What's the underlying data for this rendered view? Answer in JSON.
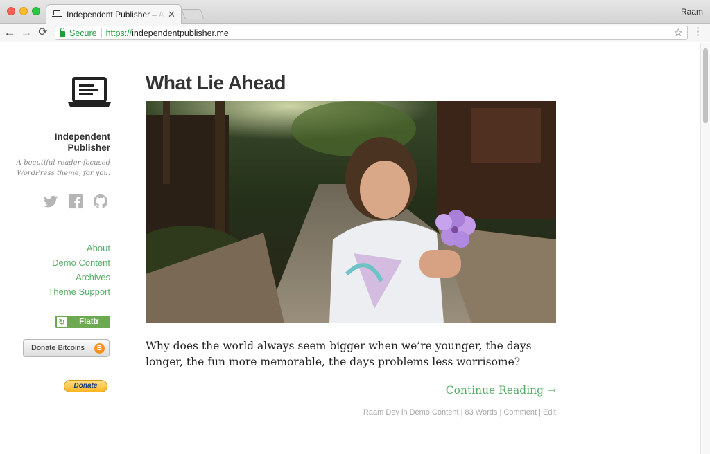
{
  "browser": {
    "tab_title": "Independent Publisher – A beautiful reader-focused WordPress theme, for you.",
    "tab_close": "✕",
    "profile_name": "Raam",
    "secure_label": "Secure",
    "url_scheme": "https://",
    "url_host": "independentpublisher.me",
    "back_icon": "←",
    "forward_icon": "→",
    "reload_icon": "⟳",
    "star_icon": "☆",
    "menu_icon": "⋮"
  },
  "sidebar": {
    "site_title": "Independent Publisher",
    "site_description": "A beautiful reader-focused WordPress theme, for you.",
    "social": [
      "twitter-icon",
      "facebook-icon",
      "github-icon"
    ],
    "nav": [
      {
        "label": "About"
      },
      {
        "label": "Demo Content"
      },
      {
        "label": "Archives"
      },
      {
        "label": "Theme Support"
      }
    ],
    "flattr_label": "Flattr",
    "bitcoin_label": "Donate Bitcoins",
    "bitcoin_symbol": "B",
    "paypal_label": "Donate"
  },
  "post": {
    "title": "What Lie Ahead",
    "excerpt": "Why does the world always seem bigger when we’re younger, the days longer, the fun more memorable, the days problems less worrisome?",
    "continue_label": "Continue Reading →",
    "meta": {
      "author": "Raam Dev",
      "in_word": "in",
      "category": "Demo Content",
      "words": "83 Words",
      "comment": "Comment",
      "edit": "Edit",
      "separator": "|"
    }
  },
  "colors": {
    "accent_green": "#57ad68",
    "text_dark": "#333333"
  }
}
